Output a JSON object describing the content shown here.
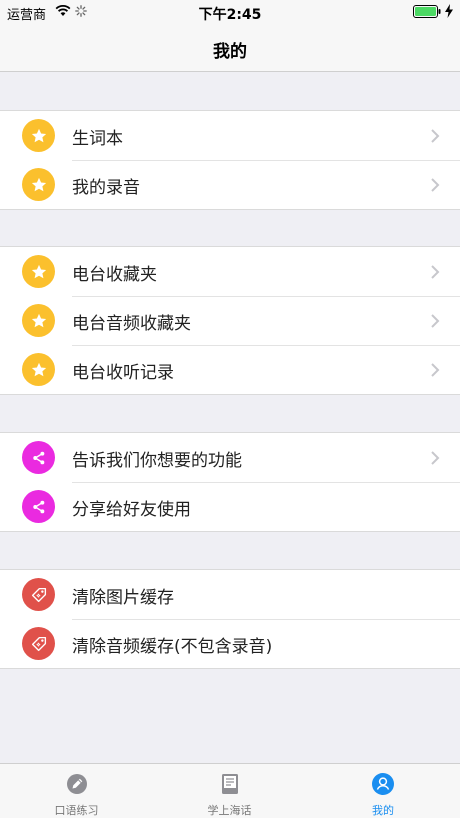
{
  "status_bar": {
    "carrier": "运营商",
    "time": "下午2:45"
  },
  "nav": {
    "title": "我的"
  },
  "groups": [
    {
      "items": [
        {
          "label": "生词本",
          "icon": "star-icon",
          "color": "#fbc02d",
          "chevron": true
        },
        {
          "label": "我的录音",
          "icon": "star-icon",
          "color": "#fbc02d",
          "chevron": true
        }
      ]
    },
    {
      "items": [
        {
          "label": "电台收藏夹",
          "icon": "star-icon",
          "color": "#fbc02d",
          "chevron": true
        },
        {
          "label": "电台音频收藏夹",
          "icon": "star-icon",
          "color": "#fbc02d",
          "chevron": true
        },
        {
          "label": "电台收听记录",
          "icon": "star-icon",
          "color": "#fbc02d",
          "chevron": true
        }
      ]
    },
    {
      "items": [
        {
          "label": "告诉我们你想要的功能",
          "icon": "share-icon",
          "color": "#ea2ae0",
          "chevron": true
        },
        {
          "label": "分享给好友使用",
          "icon": "share-icon",
          "color": "#ea2ae0",
          "chevron": false
        }
      ]
    },
    {
      "items": [
        {
          "label": "清除图片缓存",
          "icon": "tag-icon",
          "color": "#e0514a",
          "chevron": false
        },
        {
          "label": "清除音频缓存(不包含录音)",
          "icon": "tag-icon",
          "color": "#e0514a",
          "chevron": false
        }
      ]
    }
  ],
  "tab_bar": {
    "tabs": [
      {
        "label": "口语练习",
        "icon": "pencil-icon",
        "active": false
      },
      {
        "label": "学上海话",
        "icon": "book-icon",
        "active": false
      },
      {
        "label": "我的",
        "icon": "profile-icon",
        "active": true
      }
    ]
  },
  "colors": {
    "accent": "#1a8ef0",
    "star": "#fbc02d",
    "share": "#ea2ae0",
    "clear": "#e0514a",
    "background": "#efeff4"
  }
}
